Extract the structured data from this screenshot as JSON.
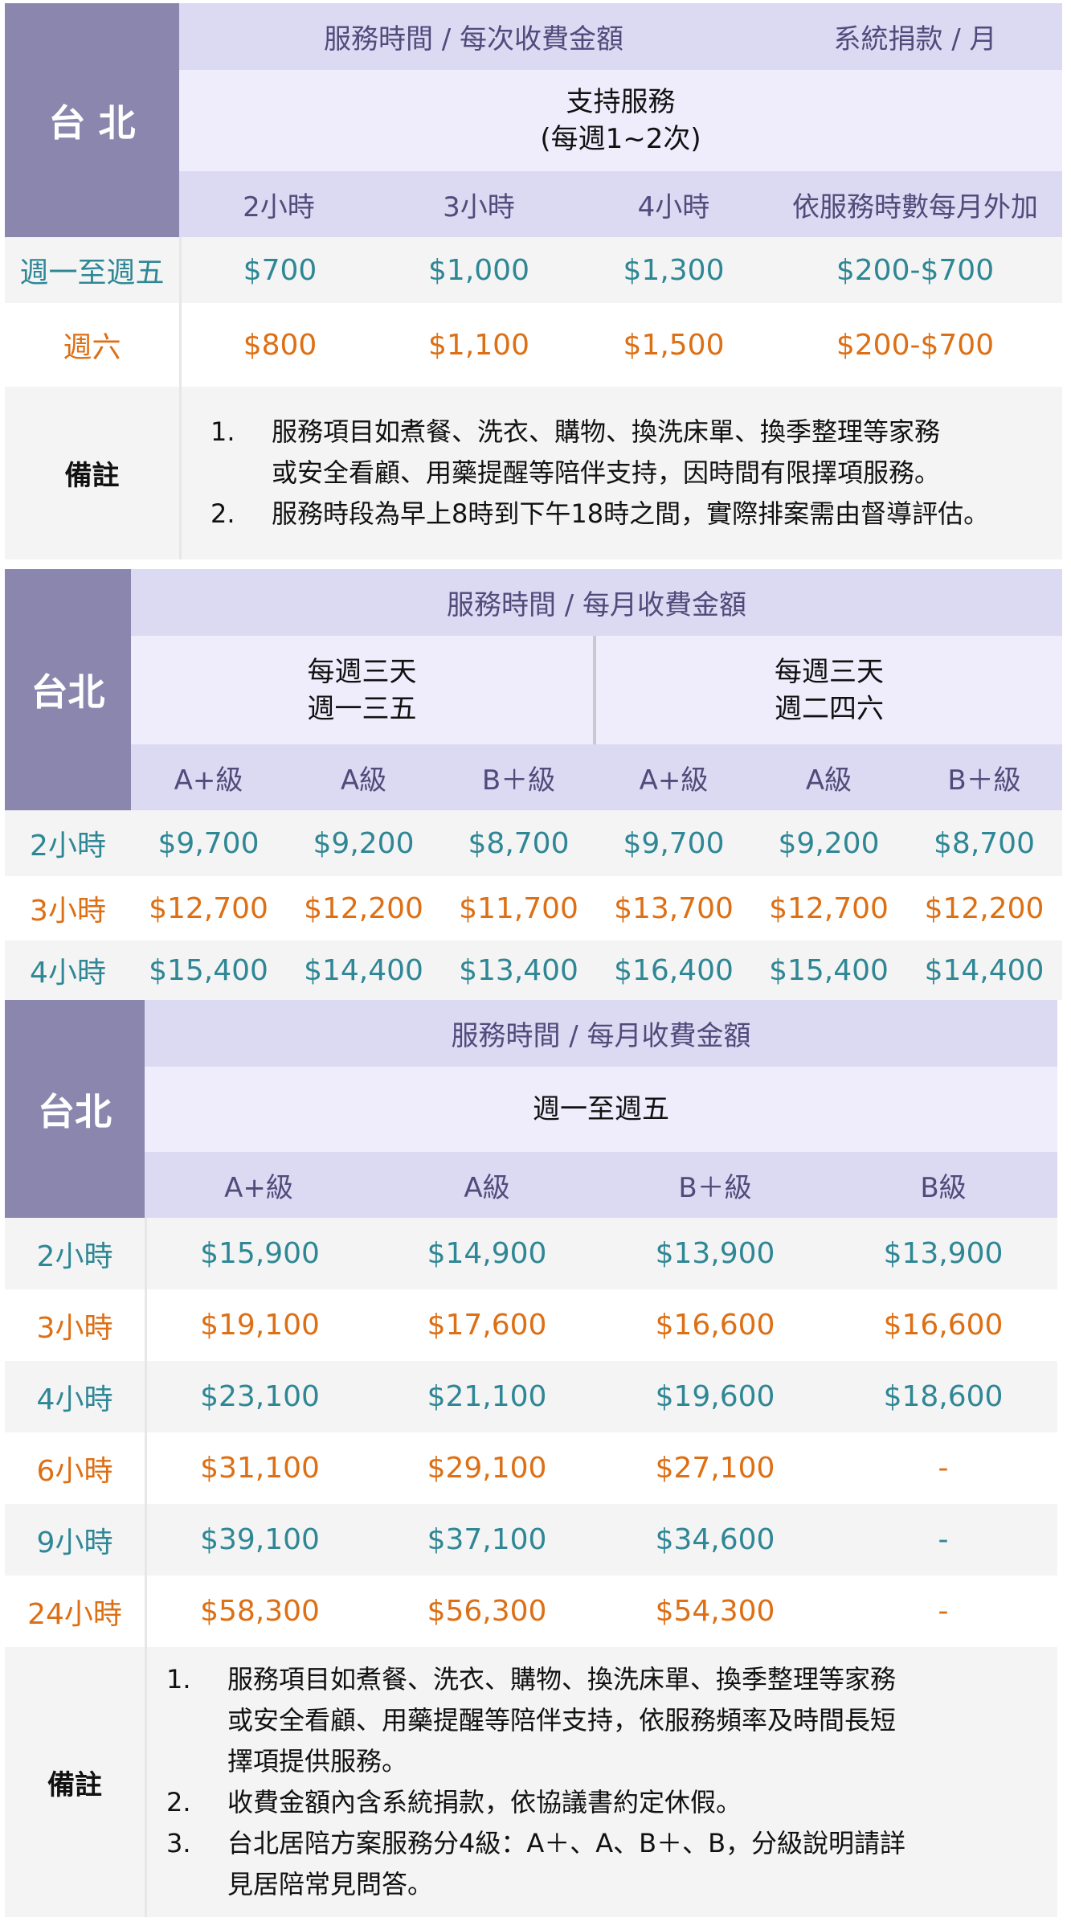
{
  "table1": {
    "city": "台 北",
    "header_time": "服務時間 / 每次收費金額",
    "header_donation": "系統捐款 / 月",
    "service_name": "支持服務",
    "service_freq": "(每週1~2次)",
    "columns": [
      "2小時",
      "3小時",
      "4小時",
      "依服務時數每月外加"
    ],
    "rows": [
      {
        "label": "週一至週五",
        "values": [
          "$700",
          "$1,000",
          "$1,300",
          "$200-$700"
        ]
      },
      {
        "label": "週六",
        "values": [
          "$800",
          "$1,100",
          "$1,500",
          "$200-$700"
        ]
      }
    ],
    "notes_label": "備註",
    "notes": [
      {
        "num": "1.",
        "lines": [
          "服務項目如煮餐、洗衣、購物、換洗床單、換季整理等家務",
          "或安全看顧、用藥提醒等陪伴支持，因時間有限擇項服務。"
        ]
      },
      {
        "num": "2.",
        "lines": [
          "服務時段為早上8時到下午18時之間，實際排案需由督導評估。"
        ]
      }
    ]
  },
  "table2": {
    "city": "台北",
    "header_time": "服務時間 / 每月收費金額",
    "group1": [
      "每週三天",
      "週一三五"
    ],
    "group2": [
      "每週三天",
      "週二四六"
    ],
    "levels": [
      "A+級",
      "A級",
      "B＋級",
      "A+級",
      "A級",
      "B＋級"
    ],
    "rows": [
      {
        "label": "2小時",
        "values": [
          "$9,700",
          "$9,200",
          "$8,700",
          "$9,700",
          "$9,200",
          "$8,700"
        ]
      },
      {
        "label": "3小時",
        "values": [
          "$12,700",
          "$12,200",
          "$11,700",
          "$13,700",
          "$12,700",
          "$12,200"
        ]
      },
      {
        "label": "4小時",
        "values": [
          "$15,400",
          "$14,400",
          "$13,400",
          "$16,400",
          "$15,400",
          "$14,400"
        ]
      }
    ]
  },
  "table3": {
    "city": "台北",
    "header_time": "服務時間 / 每月收費金額",
    "days": "週一至週五",
    "levels": [
      "A+級",
      "A級",
      "B＋級",
      "B級"
    ],
    "rows": [
      {
        "label": "2小時",
        "values": [
          "$15,900",
          "$14,900",
          "$13,900",
          "$13,900"
        ]
      },
      {
        "label": "3小時",
        "values": [
          "$19,100",
          "$17,600",
          "$16,600",
          "$16,600"
        ]
      },
      {
        "label": "4小時",
        "values": [
          "$23,100",
          "$21,100",
          "$19,600",
          "$18,600"
        ]
      },
      {
        "label": "6小時",
        "values": [
          "$31,100",
          "$29,100",
          "$27,100",
          "-"
        ]
      },
      {
        "label": "9小時",
        "values": [
          "$39,100",
          "$37,100",
          "$34,600",
          "-"
        ]
      },
      {
        "label": "24小時",
        "values": [
          "$58,300",
          "$56,300",
          "$54,300",
          "-"
        ]
      }
    ],
    "notes_label": "備註",
    "notes": [
      {
        "num": "1.",
        "lines": [
          "服務項目如煮餐、洗衣、購物、換洗床單、換季整理等家務",
          "或安全看顧、用藥提醒等陪伴支持，依服務頻率及時間長短",
          "擇項提供服務。"
        ]
      },
      {
        "num": "2.",
        "lines": [
          "收費金額內含系統捐款，依協議書約定休假。"
        ]
      },
      {
        "num": "3.",
        "lines": [
          "台北居陪方案服務分4級：A＋、A、B＋、B，分級說明請詳",
          "見居陪常見問答。"
        ]
      }
    ]
  },
  "colors": {
    "side": "#8a86ae",
    "header": "#dcdaf2",
    "subheader": "#efedfc",
    "teal": "#2f8795",
    "orange": "#dd6f14"
  }
}
